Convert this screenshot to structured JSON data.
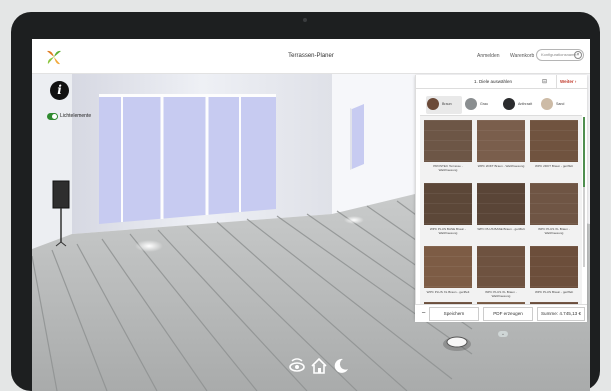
{
  "app": {
    "title": "Terrassen-Planer"
  },
  "header": {
    "login": "Anmelden",
    "cart": "Warenkorb",
    "config_placeholder": "Konfigurationsname"
  },
  "scene": {
    "toggle_label": "Lichtelemente",
    "toggle_on": true
  },
  "panel": {
    "step_title": "1. Diele auswählen",
    "next_label": "Weiter",
    "color_tabs": [
      {
        "label": "Braun",
        "color": "#6b4a38",
        "active": true
      },
      {
        "label": "Grau",
        "color": "#8a8e90",
        "active": false
      },
      {
        "label": "Anthrazit",
        "color": "#2b2c2e",
        "active": false
      },
      {
        "label": "Sand",
        "color": "#cdbba6",
        "active": false
      }
    ],
    "tiles": [
      {
        "label": "PROSTEC Terrasse - Walzfraesung",
        "color": "#6d5646"
      },
      {
        "label": "WPC 2DKT Braun - Walzfraesung",
        "color": "#7a5e4c"
      },
      {
        "label": "WPC 2DKT Braun - geriffelt",
        "color": "#70533f"
      },
      {
        "label": "WPC PLUS BASE Braun - Walzfraesung",
        "color": "#5c4738"
      },
      {
        "label": "WPC PLUS BASE Braun - geriffelt",
        "color": "#5a4537"
      },
      {
        "label": "WPC PLUS XL Braun - Walzfraesung",
        "color": "#6f5544"
      },
      {
        "label": "WPC PLUS XL Braun - geriffelt",
        "color": "#7d5c45"
      },
      {
        "label": "WPC PLUS XL Braun - Walzfraesung",
        "color": "#6e5240"
      },
      {
        "label": "WPC PLUS Braun - geriffelt",
        "color": "#6c4e3b"
      }
    ],
    "save_label": "Speichern",
    "pdf_label": "PDF erzeugen",
    "sum_label": "Summe: 4.745,13 €"
  }
}
